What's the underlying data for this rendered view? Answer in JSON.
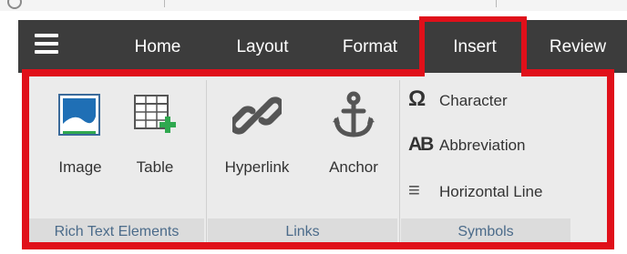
{
  "menubar": {
    "tabs": [
      {
        "label": "Home"
      },
      {
        "label": "Layout"
      },
      {
        "label": "Format"
      },
      {
        "label": "Insert"
      },
      {
        "label": "Review"
      }
    ],
    "active_tab": "Insert"
  },
  "ribbon": {
    "groups": {
      "rich_text": {
        "label": "Rich Text Elements",
        "buttons": [
          {
            "label": "Image",
            "icon": "image-icon"
          },
          {
            "label": "Table",
            "icon": "table-add-icon"
          }
        ]
      },
      "links": {
        "label": "Links",
        "buttons": [
          {
            "label": "Hyperlink",
            "icon": "link-icon"
          },
          {
            "label": "Anchor",
            "icon": "anchor-icon"
          }
        ]
      },
      "symbols": {
        "label": "Symbols",
        "buttons": [
          {
            "label": "Character",
            "glyph": "Ω",
            "icon": "omega-icon"
          },
          {
            "label": "Abbreviation",
            "glyph": "AB",
            "icon": "abbreviation-icon"
          },
          {
            "label": "Horizontal Line",
            "glyph": "≡",
            "icon": "horizontal-line-icon"
          }
        ]
      }
    }
  },
  "colors": {
    "menubar_bg": "#3c3c3c",
    "ribbon_bg": "#ebebeb",
    "group_label": "#4b6b8a",
    "annotation_red": "#e0101a",
    "image_icon_blue": "#1f6fb5",
    "table_icon_plus": "#2fa84f"
  }
}
